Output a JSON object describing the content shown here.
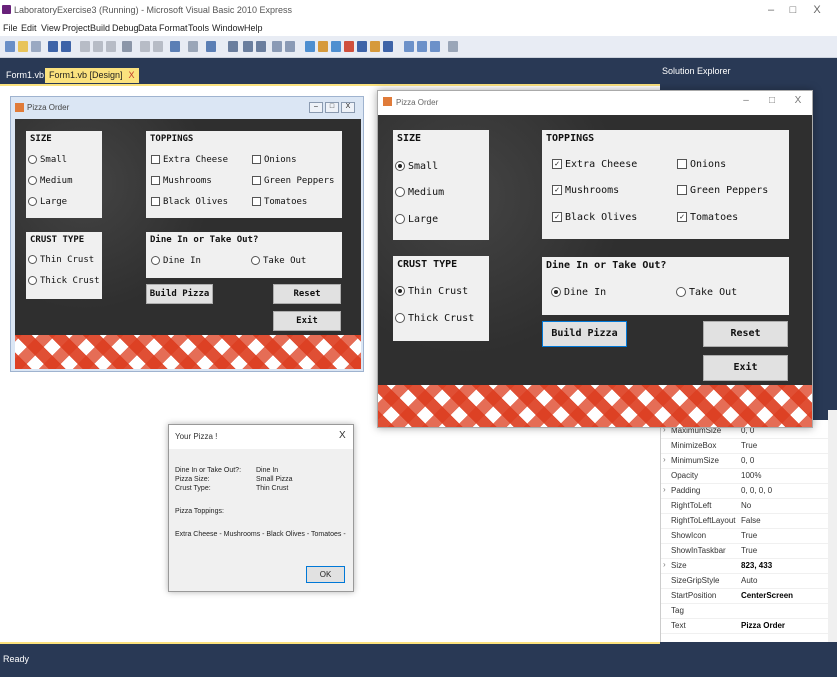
{
  "ide": {
    "title": "LaboratoryExercise3 (Running) - Microsoft Visual Basic 2010 Express",
    "menu": [
      "File",
      "Edit",
      "View",
      "Project",
      "Build",
      "Debug",
      "Data",
      "Format",
      "Tools",
      "Window",
      "Help"
    ],
    "tabs": [
      "Form1.vb",
      "Form1.vb [Design]"
    ],
    "tab_close": "X",
    "status": "Ready",
    "solution_explorer": "Solution Explorer",
    "win_min": "–",
    "win_max": "□",
    "win_close": "X"
  },
  "design_form": {
    "title": "Pizza Order",
    "size_group": "SIZE",
    "sizes": [
      "Small",
      "Medium",
      "Large"
    ],
    "toppings_group": "TOPPINGS",
    "toppings": [
      "Extra Cheese",
      "Onions",
      "Mushrooms",
      "Green Peppers",
      "Black Olives",
      "Tomatoes"
    ],
    "crust_group": "CRUST TYPE",
    "crusts": [
      "Thin Crust",
      "Thick Crust"
    ],
    "dine_group": "Dine In or Take Out?",
    "dine": [
      "Dine In",
      "Take Out"
    ],
    "build_label": "Build Pizza",
    "reset_label": "Reset",
    "exit_label": "Exit"
  },
  "run_form": {
    "title": "Pizza Order",
    "selected_size": "Small",
    "checked_toppings": [
      "Extra Cheese",
      "Mushrooms",
      "Black Olives",
      "Tomatoes"
    ],
    "selected_crust": "Thin Crust",
    "selected_dine": "Dine In"
  },
  "dialog": {
    "title": "Your Pizza !",
    "close": "X",
    "dine_label": "Dine In or Take Out?:",
    "dine_value": "Dine In",
    "size_label": "Pizza Size:",
    "size_value": "Small Pizza",
    "crust_label": "Crust Type:",
    "crust_value": "Thin Crust",
    "toppings_label": "Pizza Toppings:",
    "toppings_value": "Extra Cheese  -  Mushrooms  -  Black Olives  -  Tomatoes  -",
    "ok_label": "OK"
  },
  "properties": [
    {
      "name": "MaximumSize",
      "value": "0, 0",
      "expand": true,
      "bold": false
    },
    {
      "name": "MinimizeBox",
      "value": "True",
      "expand": false,
      "bold": false
    },
    {
      "name": "MinimumSize",
      "value": "0, 0",
      "expand": true,
      "bold": false
    },
    {
      "name": "Opacity",
      "value": "100%",
      "expand": false,
      "bold": false
    },
    {
      "name": "Padding",
      "value": "0, 0, 0, 0",
      "expand": true,
      "bold": false
    },
    {
      "name": "RightToLeft",
      "value": "No",
      "expand": false,
      "bold": false
    },
    {
      "name": "RightToLeftLayout",
      "value": "False",
      "expand": false,
      "bold": false
    },
    {
      "name": "ShowIcon",
      "value": "True",
      "expand": false,
      "bold": false
    },
    {
      "name": "ShowInTaskbar",
      "value": "True",
      "expand": false,
      "bold": false
    },
    {
      "name": "Size",
      "value": "823, 433",
      "expand": true,
      "bold": true
    },
    {
      "name": "SizeGripStyle",
      "value": "Auto",
      "expand": false,
      "bold": false
    },
    {
      "name": "StartPosition",
      "value": "CenterScreen",
      "expand": false,
      "bold": true
    },
    {
      "name": "Tag",
      "value": "",
      "expand": false,
      "bold": false
    },
    {
      "name": "Text",
      "value": "Pizza Order",
      "expand": false,
      "bold": true
    }
  ]
}
